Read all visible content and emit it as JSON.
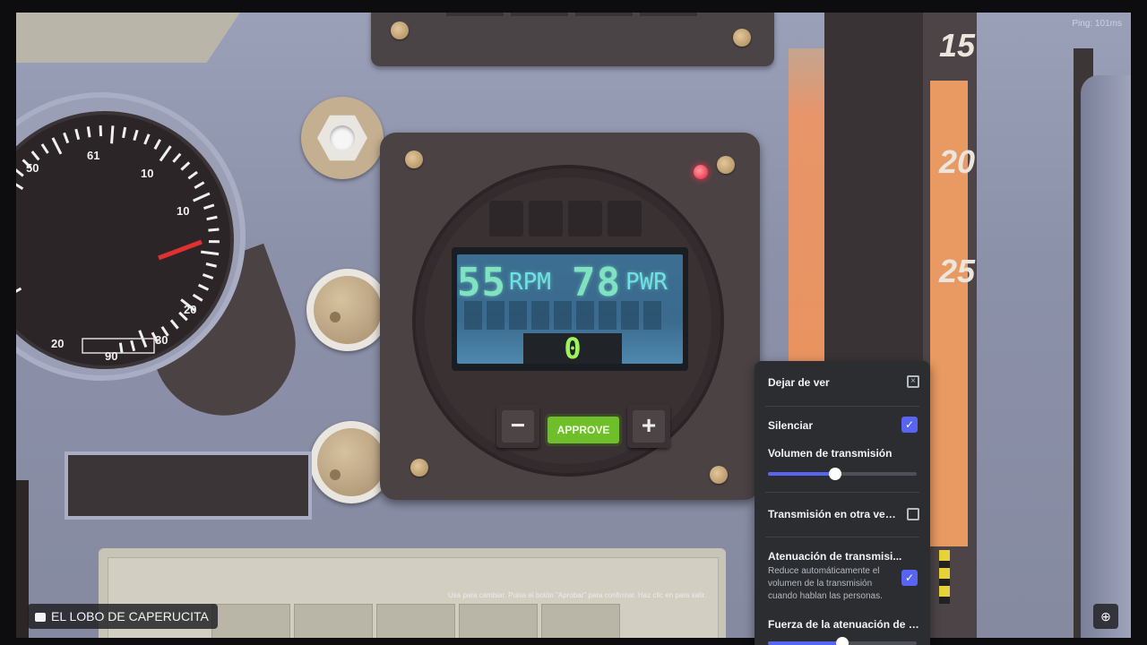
{
  "overlay": {
    "ping": "Ping: 101ms",
    "stream_name": "EL LOBO DE CAPERUCITA",
    "hint": "Usa  para cambiar. Pulsa el botón \"Aprobar\" para confirmar. Haz clic en  para salir."
  },
  "game": {
    "rpm_value": "55",
    "rpm_unit": "RPM",
    "pwr_value": "78",
    "pwr_unit": "PWR",
    "counter": "0",
    "minus_label": "−",
    "plus_label": "+",
    "approve_label": "APPROVE",
    "ruler_numbers": [
      "15",
      "20",
      "25"
    ],
    "gauge_ticks": [
      "50",
      "61",
      "10",
      "10",
      "20",
      "30",
      "90",
      "20"
    ]
  },
  "popup": {
    "stop_watching": "Dejar de ver",
    "mute_label": "Silenciar",
    "mute_checked": true,
    "volume_label": "Volumen de transmisión",
    "volume_level": 0.45,
    "popout_label": "Transmisión en otra vent...",
    "attenuation_label": "Atenuación de transmisi...",
    "attenuation_desc": "Reduce automáticamente el volumen de la transmisión cuando hablan las personas.",
    "attenuation_checked": true,
    "attenuation_strength_label": "Fuerza de la atenuación de tr...",
    "attenuation_strength": 0.5
  },
  "colors": {
    "accent": "#5865f2",
    "approve_green": "#6fbf2b",
    "lcd_cyan": "#7fe3c2",
    "counter_green": "#9ef35c",
    "led_red": "#e0203a",
    "ruler_orange": "#e89a62"
  }
}
